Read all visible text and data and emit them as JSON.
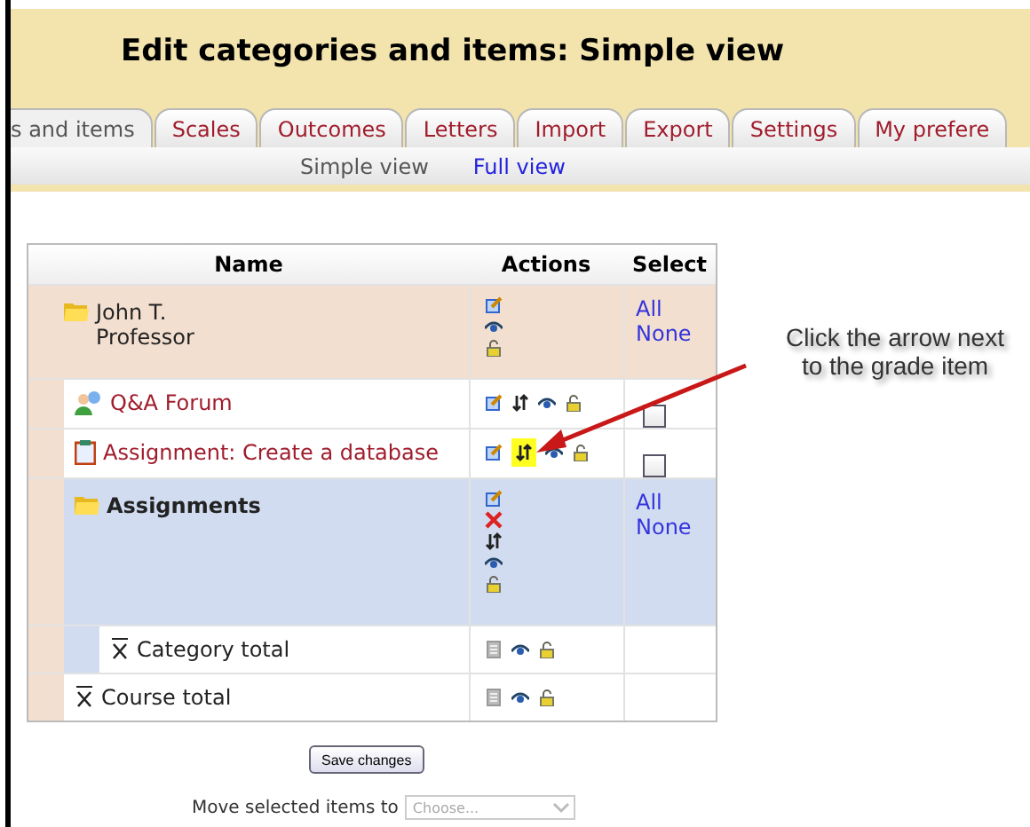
{
  "header": {
    "title": "Edit categories and items: Simple view"
  },
  "tabs": [
    {
      "label": "s and items",
      "selected": true
    },
    {
      "label": "Scales",
      "selected": false
    },
    {
      "label": "Outcomes",
      "selected": false
    },
    {
      "label": "Letters",
      "selected": false
    },
    {
      "label": "Import",
      "selected": false
    },
    {
      "label": "Export",
      "selected": false
    },
    {
      "label": "Settings",
      "selected": false
    },
    {
      "label": "My prefere",
      "selected": false
    }
  ],
  "subtabs": [
    {
      "label": "Simple view",
      "selected": true
    },
    {
      "label": "Full view",
      "selected": false
    }
  ],
  "table": {
    "columns": [
      "Name",
      "Actions",
      "Select"
    ],
    "rows": [
      {
        "kind": "category",
        "name": "John T. Professor",
        "actions": [
          {
            "kind": "edit",
            "highlighted": false
          },
          {
            "kind": "show",
            "highlighted": false
          },
          {
            "kind": "lock",
            "highlighted": false
          }
        ],
        "select_all": "All",
        "select_none": "None",
        "children": [
          {
            "kind": "forum",
            "name": "Q&A Forum",
            "actions": [
              {
                "kind": "edit",
                "highlighted": false
              },
              {
                "kind": "move",
                "highlighted": false
              },
              {
                "kind": "show",
                "highlighted": false
              },
              {
                "kind": "lock",
                "highlighted": false
              }
            ],
            "checked": false
          },
          {
            "kind": "assignment",
            "name": "Assignment: Create a database",
            "actions": [
              {
                "kind": "edit",
                "highlighted": false
              },
              {
                "kind": "move",
                "highlighted": true
              },
              {
                "kind": "show",
                "highlighted": false
              },
              {
                "kind": "lock",
                "highlighted": false
              }
            ],
            "checked": false
          },
          {
            "kind": "category",
            "name": "Assignments",
            "actions": [
              {
                "kind": "edit",
                "highlighted": false
              },
              {
                "kind": "delete",
                "highlighted": false
              },
              {
                "kind": "move",
                "highlighted": false
              },
              {
                "kind": "show",
                "highlighted": false
              },
              {
                "kind": "lock",
                "highlighted": false
              }
            ],
            "select_all": "All",
            "select_none": "None",
            "children": [
              {
                "kind": "total",
                "name": "Category total",
                "actions": [
                  {
                    "kind": "calc",
                    "highlighted": false
                  },
                  {
                    "kind": "show",
                    "highlighted": false
                  },
                  {
                    "kind": "lock",
                    "highlighted": false
                  }
                ]
              }
            ]
          },
          {
            "kind": "total",
            "name": "Course total",
            "actions": [
              {
                "kind": "calc",
                "highlighted": false
              },
              {
                "kind": "show",
                "highlighted": false
              },
              {
                "kind": "lock",
                "highlighted": false
              }
            ]
          }
        ]
      }
    ]
  },
  "save_button": "Save changes",
  "move": {
    "label": "Move selected items to",
    "placeholder": "Choose..."
  },
  "callout": "Click the arrow next to the grade item"
}
